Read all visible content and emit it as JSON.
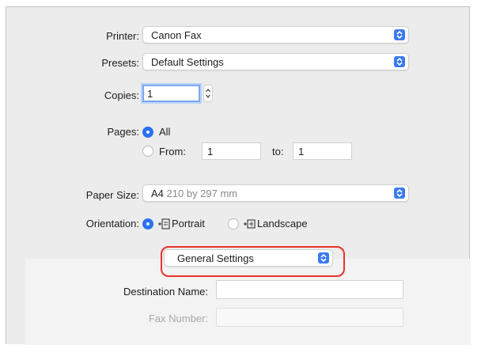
{
  "printer": {
    "label": "Printer:",
    "value": "Canon Fax"
  },
  "presets": {
    "label": "Presets:",
    "value": "Default Settings"
  },
  "copies": {
    "label": "Copies:",
    "value": "1"
  },
  "pages": {
    "label": "Pages:",
    "all_label": "All",
    "from_label": "From:",
    "from_value": "1",
    "to_label": "to:",
    "to_value": "1",
    "selected": "All"
  },
  "paper_size": {
    "label": "Paper Size:",
    "value_main": "A4",
    "value_detail": "210 by 297 mm"
  },
  "orientation": {
    "label": "Orientation:",
    "portrait_label": "Portrait",
    "landscape_label": "Landscape",
    "selected": "Portrait"
  },
  "section_popup": {
    "value": "General Settings"
  },
  "destination_name": {
    "label": "Destination Name:",
    "value": ""
  },
  "fax_number": {
    "label": "Fax Number:",
    "value": ""
  },
  "colors": {
    "accent": "#2a72ef",
    "highlight": "#e8312b"
  },
  "icons": [
    "chevron-updown-icon",
    "stepper-icon",
    "portrait-orientation-icon",
    "landscape-orientation-icon"
  ]
}
